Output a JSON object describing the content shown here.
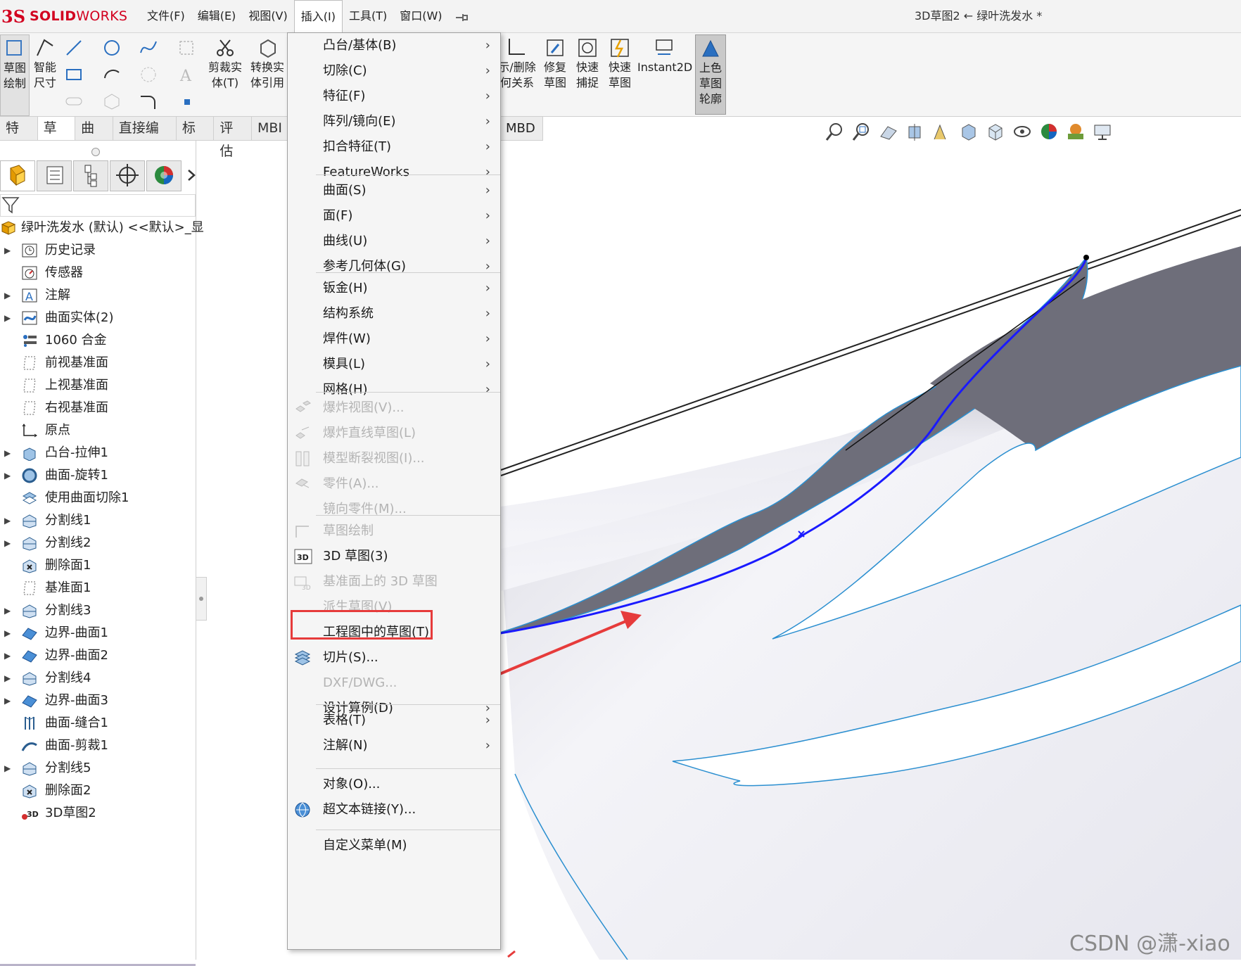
{
  "app": {
    "logo_mark": "3S",
    "logo_text_a": "SOLID",
    "logo_text_b": "WORKS",
    "doc_title": "3D草图2 ← 绿叶洗发水 *"
  },
  "menubar": [
    "文件(F)",
    "编辑(E)",
    "视图(V)",
    "插入(I)",
    "工具(T)",
    "窗口(W)"
  ],
  "ribbon": {
    "sketch_draw": [
      "草图",
      "绘制"
    ],
    "smart_dim": [
      "智能",
      "尺寸"
    ],
    "trim": [
      "剪裁实",
      "体(T)"
    ],
    "convert": [
      "转换实",
      "体引用"
    ],
    "relations": [
      "示/删除",
      "何关系"
    ],
    "repair": [
      "修复",
      "草图"
    ],
    "quick_snap": [
      "快速",
      "捕捉"
    ],
    "quick_sketch": [
      "快速",
      "草图"
    ],
    "instant2d": "Instant2D",
    "shaded": [
      "上色",
      "草图",
      "轮廓"
    ]
  },
  "tabs": [
    "特征",
    "草图",
    "曲面",
    "直接编辑",
    "标注",
    "评估",
    "MBI"
  ],
  "tab_mbd": "MBD",
  "tree": {
    "root": "绿叶洗发水 (默认) <<默认>_显",
    "items": [
      {
        "label": "历史记录",
        "exp": true,
        "icon": "history-icon"
      },
      {
        "label": "传感器",
        "exp": false,
        "icon": "sensor-icon"
      },
      {
        "label": "注解",
        "exp": true,
        "icon": "annotation-icon"
      },
      {
        "label": "曲面实体(2)",
        "exp": true,
        "icon": "surface-body-icon"
      },
      {
        "label": "1060 合金",
        "exp": false,
        "icon": "material-icon"
      },
      {
        "label": "前视基准面",
        "exp": false,
        "icon": "plane-icon"
      },
      {
        "label": "上视基准面",
        "exp": false,
        "icon": "plane-icon"
      },
      {
        "label": "右视基准面",
        "exp": false,
        "icon": "plane-icon"
      },
      {
        "label": "原点",
        "exp": false,
        "icon": "origin-icon"
      },
      {
        "label": "凸台-拉伸1",
        "exp": true,
        "icon": "extrude-icon"
      },
      {
        "label": "曲面-旋转1",
        "exp": true,
        "icon": "revolve-icon"
      },
      {
        "label": "使用曲面切除1",
        "exp": false,
        "icon": "surface-cut-icon"
      },
      {
        "label": "分割线1",
        "exp": true,
        "icon": "split-line-icon"
      },
      {
        "label": "分割线2",
        "exp": true,
        "icon": "split-line-icon"
      },
      {
        "label": "删除面1",
        "exp": false,
        "icon": "delete-face-icon"
      },
      {
        "label": "基准面1",
        "exp": false,
        "icon": "plane-icon"
      },
      {
        "label": "分割线3",
        "exp": true,
        "icon": "split-line-icon"
      },
      {
        "label": "边界-曲面1",
        "exp": true,
        "icon": "boundary-surface-icon"
      },
      {
        "label": "边界-曲面2",
        "exp": true,
        "icon": "boundary-surface-icon"
      },
      {
        "label": "分割线4",
        "exp": true,
        "icon": "split-line-icon"
      },
      {
        "label": "边界-曲面3",
        "exp": true,
        "icon": "boundary-surface-icon"
      },
      {
        "label": "曲面-缝合1",
        "exp": false,
        "icon": "knit-icon"
      },
      {
        "label": "曲面-剪裁1",
        "exp": false,
        "icon": "trim-surface-icon"
      },
      {
        "label": "分割线5",
        "exp": true,
        "icon": "split-line-icon"
      },
      {
        "label": "删除面2",
        "exp": false,
        "icon": "delete-face-icon"
      },
      {
        "label": "3D草图2",
        "exp": false,
        "icon": "sketch3d-icon"
      }
    ]
  },
  "dropdown": {
    "groups": [
      [
        {
          "label": "凸台/基体(B)",
          "arrow": true,
          "disabled": false
        },
        {
          "label": "切除(C)",
          "arrow": true,
          "disabled": false
        },
        {
          "label": "特征(F)",
          "arrow": true,
          "disabled": false
        },
        {
          "label": "阵列/镜向(E)",
          "arrow": true,
          "disabled": false
        },
        {
          "label": "扣合特征(T)",
          "arrow": true,
          "disabled": false
        },
        {
          "label": "FeatureWorks",
          "arrow": true,
          "disabled": false
        }
      ],
      [
        {
          "label": "曲面(S)",
          "arrow": true,
          "disabled": false
        },
        {
          "label": "面(F)",
          "arrow": true,
          "disabled": false
        },
        {
          "label": "曲线(U)",
          "arrow": true,
          "disabled": false
        },
        {
          "label": "参考几何体(G)",
          "arrow": true,
          "disabled": false
        }
      ],
      [
        {
          "label": "钣金(H)",
          "arrow": true,
          "disabled": false
        },
        {
          "label": "结构系统",
          "arrow": true,
          "disabled": false
        },
        {
          "label": "焊件(W)",
          "arrow": true,
          "disabled": false
        },
        {
          "label": "模具(L)",
          "arrow": true,
          "disabled": false
        },
        {
          "label": "网格(H)",
          "arrow": true,
          "disabled": false
        }
      ],
      [
        {
          "label": "爆炸视图(V)...",
          "arrow": false,
          "disabled": true,
          "icon": "explode-icon"
        },
        {
          "label": "爆炸直线草图(L)",
          "arrow": false,
          "disabled": true,
          "icon": "explode-line-icon"
        },
        {
          "label": "模型断裂视图(I)...",
          "arrow": false,
          "disabled": true,
          "icon": "break-view-icon"
        },
        {
          "label": "零件(A)...",
          "arrow": false,
          "disabled": true,
          "icon": "part-icon"
        },
        {
          "label": "镜向零件(M)...",
          "arrow": false,
          "disabled": true
        }
      ],
      [
        {
          "label": "草图绘制",
          "arrow": false,
          "disabled": true,
          "icon": "sketch-icon"
        },
        {
          "label": "3D 草图(3)",
          "arrow": false,
          "disabled": false,
          "icon": "sketch3d-icon"
        },
        {
          "label": "基准面上的 3D 草图",
          "arrow": false,
          "disabled": true,
          "icon": "sketch3d-plane-icon"
        },
        {
          "label": "派生草图(V)",
          "arrow": false,
          "disabled": true
        },
        {
          "label": "工程图中的草图(T)",
          "arrow": false,
          "disabled": false
        },
        {
          "label": "切片(S)...",
          "arrow": false,
          "disabled": false,
          "icon": "slice-icon"
        },
        {
          "label": "DXF/DWG...",
          "arrow": false,
          "disabled": true
        },
        {
          "label": "设计算例(D)",
          "arrow": true,
          "disabled": false
        }
      ],
      [
        {
          "label": "表格(T)",
          "arrow": true,
          "disabled": false
        },
        {
          "label": "注解(N)",
          "arrow": true,
          "disabled": false
        }
      ],
      [
        {
          "label": "对象(O)...",
          "arrow": false,
          "disabled": false
        },
        {
          "label": "超文本链接(Y)...",
          "arrow": false,
          "disabled": false,
          "icon": "hyperlink-icon"
        }
      ],
      [
        {
          "label": "自定义菜单(M)",
          "arrow": false,
          "disabled": false
        }
      ]
    ]
  },
  "watermark": "CSDN @潇-xiao",
  "colors": {
    "accent_red": "#e63b3b",
    "sketch_blue": "#1a1aff",
    "surface_gray": "#6e6e7a",
    "logo_red": "#d2001f"
  }
}
